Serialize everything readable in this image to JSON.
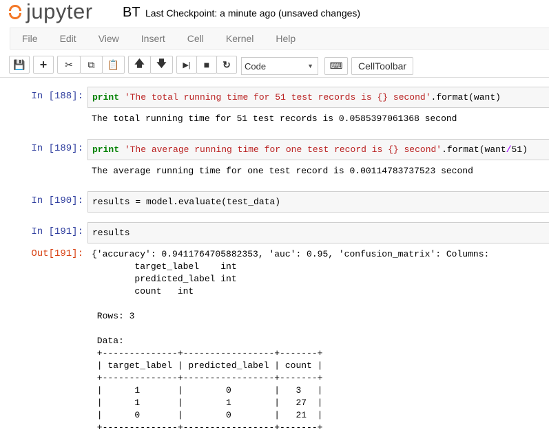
{
  "header": {
    "logo_text": "jupyter",
    "notebook_name": "BT",
    "checkpoint": "Last Checkpoint: a minute ago (unsaved changes)"
  },
  "menu": [
    "File",
    "Edit",
    "View",
    "Insert",
    "Cell",
    "Kernel",
    "Help"
  ],
  "toolbar": {
    "cell_type": "Code",
    "celltoolbar_label": "CellToolbar",
    "icons": [
      "save-icon",
      "plus-icon",
      "cut-icon",
      "copy-icon",
      "paste-icon",
      "arrow-up-icon",
      "arrow-down-icon",
      "step-forward-icon",
      "stop-icon",
      "refresh-icon",
      "keyboard-icon"
    ]
  },
  "cells": [
    {
      "prompt": "In [188]:",
      "code": {
        "kw": "print",
        "str": "'The total running time for 51 test records is {} second'",
        "rest1": ".format(want)",
        "op": "",
        "rest2": ""
      },
      "output": "The total running time for 51 test records is 0.0585397061368 second"
    },
    {
      "prompt": "In [189]:",
      "code": {
        "kw": "print",
        "str": "'The average running time for one test record is {} second'",
        "rest1": ".format(want",
        "op": "/",
        "rest2": "51)"
      },
      "output": "The average running time for one test record is 0.00114783737523 second"
    },
    {
      "prompt": "In [190]:",
      "code": {
        "text": "results = model.evaluate(test_data)"
      }
    },
    {
      "prompt": "In [191]:",
      "code": {
        "text": "results"
      },
      "out_prompt": "Out[191]:",
      "output": "{'accuracy': 0.9411764705882353, 'auc': 0.95, 'confusion_matrix': Columns:\n        target_label    int\n        predicted_label int\n        count   int\n\n Rows: 3\n\n Data:\n +--------------+-----------------+-------+\n | target_label | predicted_label | count |\n +--------------+-----------------+-------+\n |      1       |        0        |   3   |\n |      1       |        1        |   27  |\n |      0       |        0        |   21  |\n +--------------+-----------------+-------+"
    }
  ]
}
